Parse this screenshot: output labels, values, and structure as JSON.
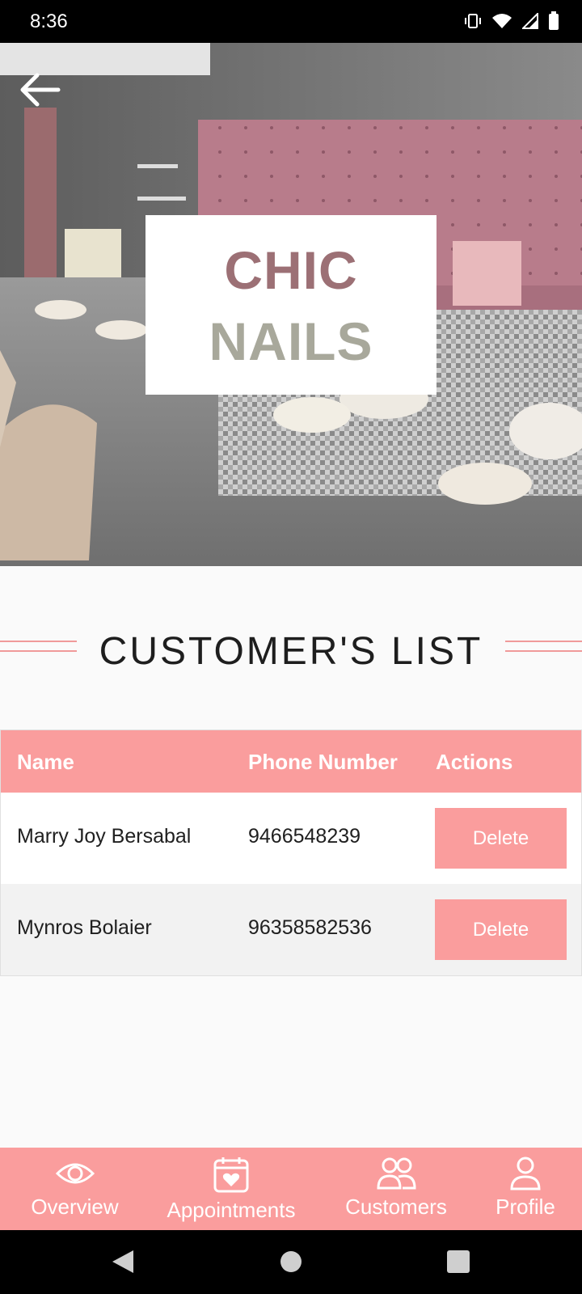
{
  "status_bar": {
    "time": "8:36"
  },
  "hero": {
    "logo_line1": "CHIC",
    "logo_line2": "NAILS"
  },
  "section": {
    "title": "CUSTOMER'S LIST"
  },
  "table": {
    "headers": {
      "name": "Name",
      "phone": "Phone Number",
      "actions": "Actions"
    },
    "rows": [
      {
        "name": "Marry Joy Bersabal",
        "phone": "9466548239",
        "action_label": "Delete"
      },
      {
        "name": "Mynros Bolaier",
        "phone": "96358582536",
        "action_label": "Delete"
      }
    ]
  },
  "bottom_nav": {
    "items": [
      {
        "label": "Overview",
        "icon": "eye-icon"
      },
      {
        "label": "Appointments",
        "icon": "calendar-heart-icon"
      },
      {
        "label": "Customers",
        "icon": "users-icon"
      },
      {
        "label": "Profile",
        "icon": "user-icon"
      }
    ]
  },
  "colors": {
    "accent": "#fa9d9d",
    "status_bar": "#000000"
  }
}
